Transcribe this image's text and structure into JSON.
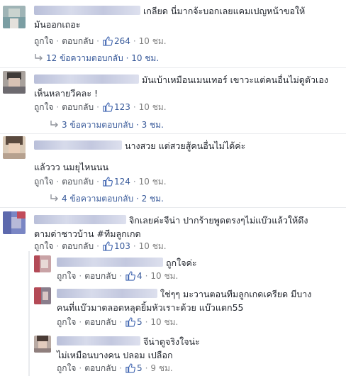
{
  "actions": {
    "like": "ถูกใจ",
    "reply": "ตอบกลับ",
    "separator": "·"
  },
  "comments": [
    {
      "text_line1": "เกลียด นี่มากจ้ะบอกเลยแคมเปญหน้าขอให้",
      "text_line2": "มันออกเถอะ",
      "likes": "264",
      "time": "10 ชม.",
      "replies": "12 ข้อความตอบกลับ · 10 ชม."
    },
    {
      "text_line1": "มันเบ้าเหมือนเมนเทอร์ เขาวะแต่คนอื่นไม่ดูตัวเอง",
      "text_line2": "เห็นหลายวีคละ !",
      "likes": "123",
      "time": "10 ชม.",
      "replies": "3 ข้อความตอบกลับ · 3 ชม."
    },
    {
      "text_line1": "นางสวย แต่สวยสู้คนอื่นไม่ได้ค่ะ",
      "text_line2": "แล้ววว นมยุไหนนน",
      "likes": "124",
      "time": "10 ชม.",
      "replies": "4 ข้อความตอบกลับ · 2 ชม."
    },
    {
      "text_line1": "จิกเลยค่ะจีน่า ปากร้ายพูดตรงๆไม่แบ๊วแล้วให้ดึง",
      "text_line2": "ตามด่าชาวบ้าน #ทีมลูกเกด",
      "likes": "103",
      "time": "10 ชม."
    }
  ],
  "nested_replies": [
    {
      "text_line1": "ถูกใจค่ะ",
      "text_line2": "",
      "likes": "4",
      "time": "10 ชม."
    },
    {
      "text_line1": "ใช่ๆๆ มะวานตอนทีมลูกเกดเครียด มีบาง",
      "text_line2": "คนที่แบ๊วมาตลอดหลุดยิ้มหัวเราะด้วย แบ๊วแตก55",
      "likes": "5",
      "time": "10 ชม."
    },
    {
      "text_line1": "จีน่าดูจริงใจน่ะ",
      "text_line2": "ไม่เหมือนบางคน ปลอม เปลือก",
      "likes": "5",
      "time": "9 ชม."
    }
  ]
}
